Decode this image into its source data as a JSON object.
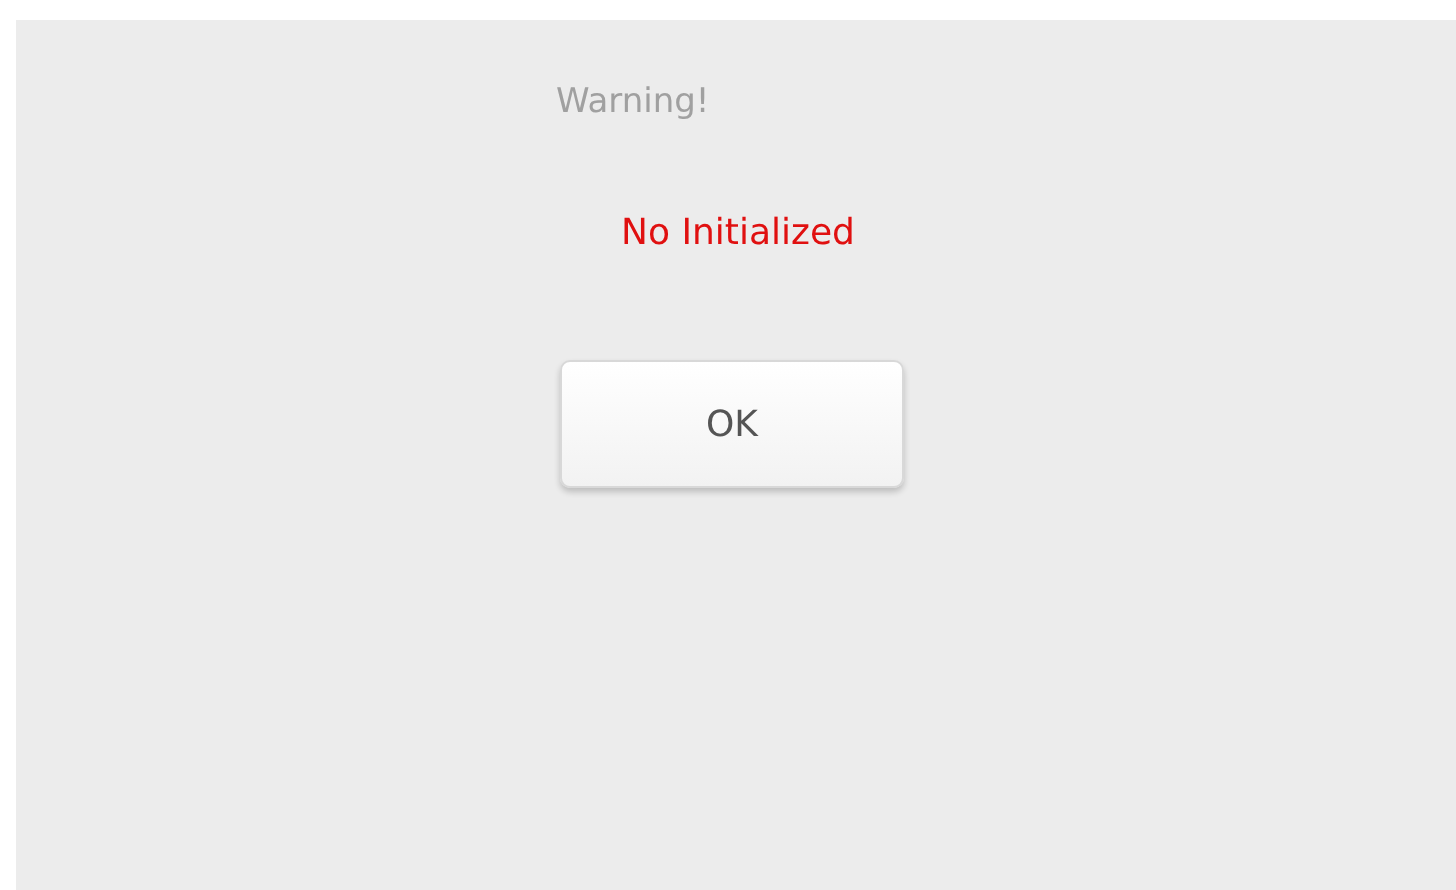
{
  "dialog": {
    "title": "Warning!",
    "message": "No Initialized",
    "buttons": [
      "OK"
    ]
  }
}
